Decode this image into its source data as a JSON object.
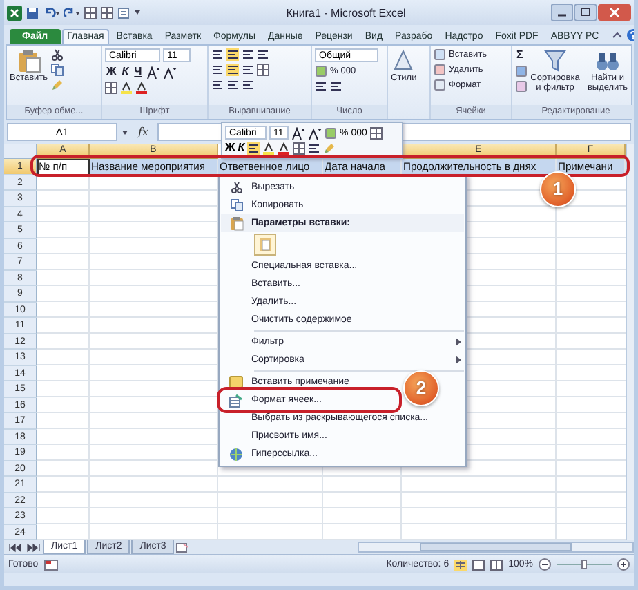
{
  "window": {
    "title": "Книга1 - Microsoft Excel"
  },
  "ribbon_tabs": [
    {
      "label": "Файл",
      "kind": "file",
      "selected": false
    },
    {
      "label": "Главная",
      "kind": "tab",
      "selected": true
    },
    {
      "label": "Вставка",
      "kind": "tab",
      "selected": false
    },
    {
      "label": "Разметк",
      "kind": "tab",
      "selected": false
    },
    {
      "label": "Формулы",
      "kind": "tab",
      "selected": false
    },
    {
      "label": "Данные",
      "kind": "tab",
      "selected": false
    },
    {
      "label": "Рецензи",
      "kind": "tab",
      "selected": false
    },
    {
      "label": "Вид",
      "kind": "tab",
      "selected": false
    },
    {
      "label": "Разрабо",
      "kind": "tab",
      "selected": false
    },
    {
      "label": "Надстро",
      "kind": "tab",
      "selected": false
    },
    {
      "label": "Foxit PDF",
      "kind": "tab",
      "selected": false
    },
    {
      "label": "ABBYY PC",
      "kind": "tab",
      "selected": false
    }
  ],
  "ribbon": {
    "clipboard": {
      "label": "Буфер обме...",
      "paste": "Вставить"
    },
    "font": {
      "label": "Шрифт",
      "family": "Calibri",
      "size": "11",
      "bold": "Ж",
      "italic": "К",
      "underline": "Ч"
    },
    "alignment": {
      "label": "Выравнивание"
    },
    "number": {
      "label": "Число",
      "format": "Общий",
      "percent": "%",
      "thousands": "000"
    },
    "styles": {
      "button": "Стили"
    },
    "cells": {
      "label": "Ячейки",
      "buttons": [
        "Вставить",
        "Удалить",
        "Формат"
      ]
    },
    "editing": {
      "label": "Редактирование",
      "sum": "Σ",
      "sort": "Сортировка и фильтр",
      "find": "Найти и выделить"
    }
  },
  "formula_bar": {
    "name_box": "A1",
    "function_label": "fx"
  },
  "mini_toolbar": {
    "font": "Calibri",
    "size": "11",
    "percent": "%",
    "thousands": "000",
    "bold": "Ж",
    "italic": "К"
  },
  "columns": [
    {
      "label": "A"
    },
    {
      "label": "B"
    },
    {},
    {},
    {
      "label": "E"
    },
    {
      "label": "F"
    }
  ],
  "rows": [
    {
      "number": "1",
      "selected": true,
      "cells": [
        "№ п/п",
        "Название мероприятия",
        "Ответвенное лицо",
        "Дата начала",
        "Продолжительность в днях",
        "Примечани"
      ]
    },
    {
      "number": "2",
      "selected": false
    },
    {
      "number": "3",
      "selected": false
    },
    {
      "number": "4",
      "selected": false
    },
    {
      "number": "5",
      "selected": false
    },
    {
      "number": "6",
      "selected": false
    },
    {
      "number": "7",
      "selected": false
    },
    {
      "number": "8",
      "selected": false
    },
    {
      "number": "9",
      "selected": false
    },
    {
      "number": "10",
      "selected": false
    },
    {
      "number": "11",
      "selected": false
    },
    {
      "number": "12",
      "selected": false
    },
    {
      "number": "13",
      "selected": false
    },
    {
      "number": "14",
      "selected": false
    },
    {
      "number": "15",
      "selected": false
    },
    {
      "number": "16",
      "selected": false
    },
    {
      "number": "17",
      "selected": false
    },
    {
      "number": "18",
      "selected": false
    },
    {
      "number": "19",
      "selected": false
    },
    {
      "number": "20",
      "selected": false
    },
    {
      "number": "21",
      "selected": false
    },
    {
      "number": "22",
      "selected": false
    },
    {
      "number": "23",
      "selected": false
    },
    {
      "number": "24",
      "selected": false
    }
  ],
  "context_menu": {
    "items": [
      {
        "kind": "cut",
        "label": "Вырезать"
      },
      {
        "kind": "copy",
        "label": "Копировать"
      },
      {
        "kind": "heading",
        "label": "Параметры вставки:"
      },
      {
        "kind": "paste-option"
      },
      {
        "kind": "command",
        "label": "Специальная вставка..."
      },
      {
        "kind": "command",
        "label": "Вставить..."
      },
      {
        "kind": "command",
        "label": "Удалить..."
      },
      {
        "kind": "command",
        "label": "Очистить содержимое"
      },
      {
        "kind": "separator"
      },
      {
        "kind": "submenu",
        "label": "Фильтр"
      },
      {
        "kind": "submenu",
        "label": "Сортировка"
      },
      {
        "kind": "separator"
      },
      {
        "kind": "comment",
        "label": "Вставить примечание"
      },
      {
        "kind": "format",
        "label": "Формат ячеек...",
        "highlighted": true
      },
      {
        "kind": "command",
        "label": "Выбрать из раскрывающегося списка..."
      },
      {
        "kind": "command",
        "label": "Присвоить имя..."
      },
      {
        "kind": "hyperlink",
        "label": "Гиперссылка..."
      }
    ]
  },
  "callouts": [
    {
      "label": "1"
    },
    {
      "label": "2"
    }
  ],
  "sheet_tabs": [
    {
      "label": "Лист1",
      "selected": true
    },
    {
      "label": "Лист2",
      "selected": false
    },
    {
      "label": "Лист3",
      "selected": false
    }
  ],
  "status_bar": {
    "status": "Готово",
    "count": "Количество: 6",
    "zoom": "100%",
    "zoom_slider": {
      "level": 0.5
    }
  }
}
